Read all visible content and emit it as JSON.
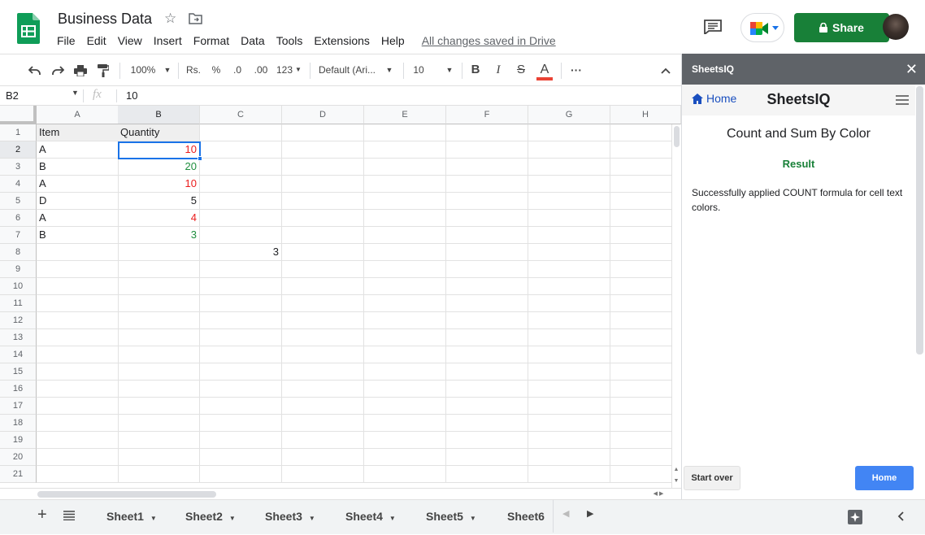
{
  "app": {
    "doc_title": "Business Data",
    "menu": [
      "File",
      "Edit",
      "View",
      "Insert",
      "Format",
      "Data",
      "Tools",
      "Extensions",
      "Help"
    ],
    "save_status": "All changes saved in Drive",
    "share_label": "Share"
  },
  "toolbar": {
    "zoom": "100%",
    "currency": "Rs.",
    "percent": "%",
    "dec_decrease": ".0",
    "dec_increase": ".00",
    "more_formats": "123",
    "font": "Default (Ari...",
    "font_size": "10",
    "bold": "B",
    "italic": "I",
    "strike": "S",
    "text_color": "A",
    "more": "···",
    "text_color_value": "#ea4335"
  },
  "formula_bar": {
    "cell_ref": "B2",
    "fx": "fx",
    "value": "10"
  },
  "grid": {
    "columns": [
      "A",
      "B",
      "C",
      "D",
      "E",
      "F",
      "G",
      "H"
    ],
    "rows": [
      "1",
      "2",
      "3",
      "4",
      "5",
      "6",
      "7",
      "8",
      "9",
      "10",
      "11",
      "12",
      "13",
      "14",
      "15",
      "16",
      "17",
      "18",
      "19",
      "20",
      "21"
    ],
    "cells": {
      "A1": "Item",
      "B1": "Quantity",
      "A2": "A",
      "B2": "10",
      "A3": "B",
      "B3": "20",
      "A4": "A",
      "B4": "10",
      "A5": "D",
      "B5": "5",
      "A6": "A",
      "B6": "4",
      "A7": "B",
      "B7": "3",
      "C8": "3"
    },
    "colors": {
      "red": "#ea1c1c",
      "green": "#1e8e3e",
      "black": "#000000"
    }
  },
  "sheets": [
    "Sheet1",
    "Sheet2",
    "Sheet3",
    "Sheet4",
    "Sheet5",
    "Sheet6"
  ],
  "sidebar": {
    "header": "SheetsIQ",
    "home_link": "Home",
    "brand": "SheetsIQ",
    "title": "Count and Sum By Color",
    "result_label": "Result",
    "message": "Successfully applied COUNT formula for cell text colors.",
    "start_over": "Start over",
    "home_button": "Home"
  }
}
